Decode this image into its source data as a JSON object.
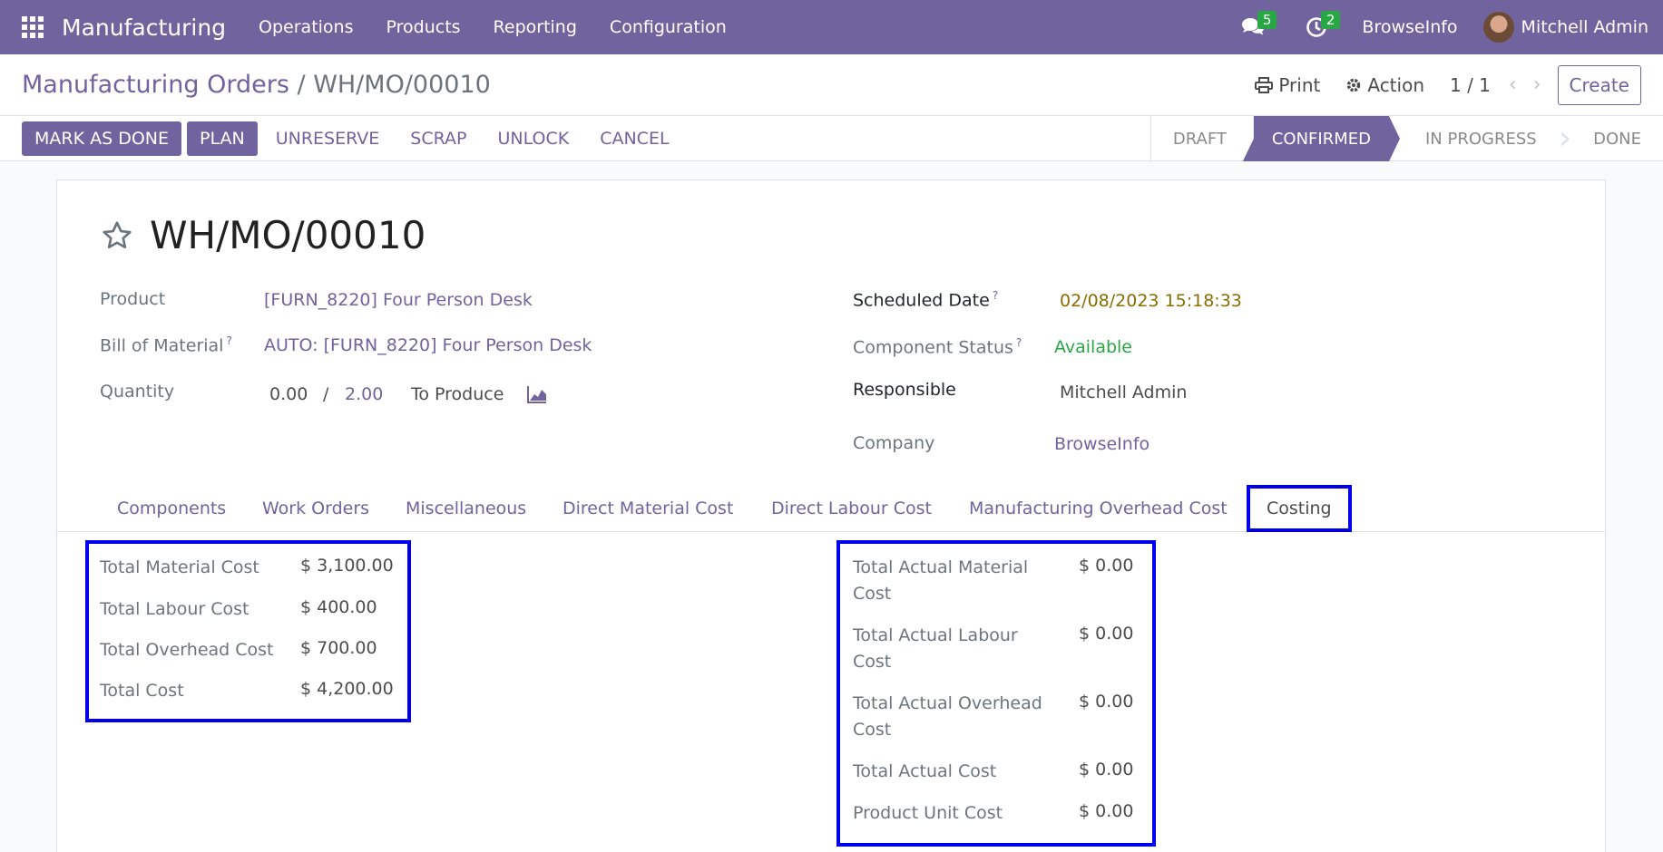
{
  "topnav": {
    "app_name": "Manufacturing",
    "menu": [
      "Operations",
      "Products",
      "Reporting",
      "Configuration"
    ],
    "messages_count": "5",
    "activities_count": "2",
    "company": "BrowseInfo",
    "user": "Mitchell Admin"
  },
  "control": {
    "breadcrumb_root": "Manufacturing Orders",
    "breadcrumb_sep": "/",
    "breadcrumb_current": "WH/MO/00010",
    "print_label": "Print",
    "action_label": "Action",
    "pager": "1 / 1",
    "create_label": "Create"
  },
  "statusbar": {
    "mark_done": "MARK AS DONE",
    "plan": "PLAN",
    "unreserve": "UNRESERVE",
    "scrap": "SCRAP",
    "unlock": "UNLOCK",
    "cancel": "CANCEL",
    "stages": [
      "DRAFT",
      "CONFIRMED",
      "IN PROGRESS",
      "DONE"
    ],
    "active_stage": "CONFIRMED"
  },
  "record": {
    "title": "WH/MO/00010",
    "product_label": "Product",
    "product_value": "[FURN_8220] Four Person Desk",
    "bom_label": "Bill of Material",
    "bom_value": "AUTO: [FURN_8220] Four Person Desk",
    "quantity_label": "Quantity",
    "qty_produced": "0.00",
    "qty_sep": "/",
    "qty_total": "2.00",
    "to_produce": "To Produce",
    "scheduled_label": "Scheduled Date",
    "scheduled_value": "02/08/2023 15:18:33",
    "component_status_label": "Component Status",
    "component_status_value": "Available",
    "responsible_label": "Responsible",
    "responsible_value": "Mitchell Admin",
    "company_label": "Company",
    "company_value": "BrowseInfo",
    "help_mark": "?"
  },
  "tabs": [
    "Components",
    "Work Orders",
    "Miscellaneous",
    "Direct Material Cost",
    "Direct Labour Cost",
    "Manufacturing Overhead Cost",
    "Costing"
  ],
  "costing": {
    "planned": [
      {
        "label": "Total Material Cost",
        "value": "$ 3,100.00"
      },
      {
        "label": "Total Labour Cost",
        "value": "$ 400.00"
      },
      {
        "label": "Total Overhead Cost",
        "value": "$ 700.00"
      },
      {
        "label": "Total Cost",
        "value": "$ 4,200.00"
      }
    ],
    "actual": [
      {
        "label1": "Total Actual Material",
        "label2": "Cost",
        "value": "$ 0.00"
      },
      {
        "label1": "Total Actual Labour",
        "label2": "Cost",
        "value": "$ 0.00"
      },
      {
        "label1": "Total Actual Overhead",
        "label2": "Cost",
        "value": "$ 0.00"
      },
      {
        "label1": "Total Actual Cost",
        "label2": "",
        "value": "$ 0.00"
      },
      {
        "label1": "Product Unit Cost",
        "label2": "",
        "value": "$ 0.00"
      }
    ]
  },
  "colors": {
    "brand": "#71639e",
    "badge": "#28a745",
    "highlight": "#0000ee",
    "available": "#28a745",
    "date": "#8a6d00"
  }
}
